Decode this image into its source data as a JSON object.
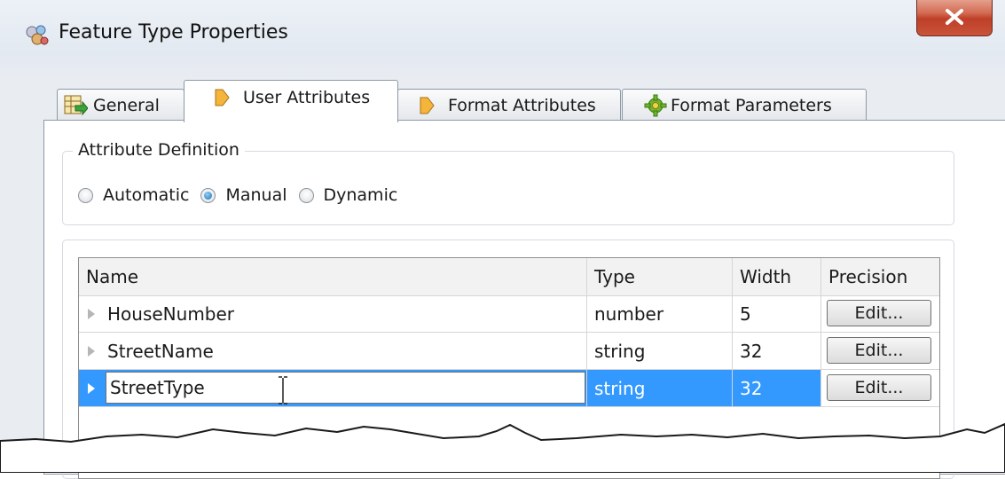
{
  "window": {
    "title": "Feature Type Properties",
    "close_symbol": "X"
  },
  "tabs": [
    {
      "label": "General",
      "icon": "table-arrow-icon",
      "active": false
    },
    {
      "label": "User Attributes",
      "icon": "diamond-arrow-icon",
      "active": true
    },
    {
      "label": "Format Attributes",
      "icon": "diamond-arrow-icon",
      "active": false
    },
    {
      "label": "Format Parameters",
      "icon": "gear-icon",
      "active": false
    }
  ],
  "attribute_definition": {
    "label": "Attribute Definition",
    "options": [
      {
        "label": "Automatic",
        "selected": false
      },
      {
        "label": "Manual",
        "selected": true
      },
      {
        "label": "Dynamic",
        "selected": false
      }
    ]
  },
  "table": {
    "columns": [
      "Name",
      "Type",
      "Width",
      "Precision"
    ],
    "rows": [
      {
        "name": "HouseNumber",
        "type": "number",
        "width": "5",
        "precision": "Edit..."
      },
      {
        "name": "StreetName",
        "type": "string",
        "width": "32",
        "precision": "Edit..."
      },
      {
        "name": "StreetType",
        "type": "string",
        "width": "32",
        "precision": "Edit...",
        "selected": true,
        "editing": true
      }
    ]
  },
  "colors": {
    "selection": "#3399ff",
    "close_button": "#c9533b"
  }
}
